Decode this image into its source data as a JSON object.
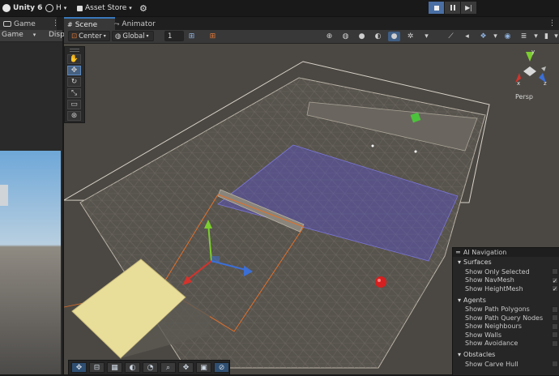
{
  "topbar": {
    "app_name": "Unity 6",
    "account_label": "H",
    "asset_store": "Asset Store"
  },
  "tabs": {
    "game": "Game",
    "scene": "Scene",
    "animator": "Animator"
  },
  "game_view": {
    "display_select": "Game",
    "display_label": "Disp"
  },
  "scene_toolbar": {
    "pivot_mode": "Center",
    "pivot_rotation": "Global",
    "grid_snap_value": "1"
  },
  "gizmo": {
    "projection": "Persp",
    "axis_y": "y",
    "axis_x": "x",
    "axis_z": "z"
  },
  "ai_navigation": {
    "title": "AI Navigation",
    "sections": [
      {
        "name": "Surfaces",
        "items": [
          {
            "label": "Show Only Selected",
            "checked": false
          },
          {
            "label": "Show NavMesh",
            "checked": true
          },
          {
            "label": "Show HeightMesh",
            "checked": true
          }
        ]
      },
      {
        "name": "Agents",
        "items": [
          {
            "label": "Show Path Polygons",
            "checked": false
          },
          {
            "label": "Show Path Query Nodes",
            "checked": false
          },
          {
            "label": "Show Neighbours",
            "checked": false
          },
          {
            "label": "Show Walls",
            "checked": false
          },
          {
            "label": "Show Avoidance",
            "checked": false
          }
        ]
      },
      {
        "name": "Obstacles",
        "items": [
          {
            "label": "Show Carve Hull",
            "checked": false
          }
        ]
      }
    ]
  },
  "colors": {
    "accent_blue": "#3a79bb",
    "navmesh_region": "#5a55c8",
    "selection_orange": "#e0702a",
    "gizmo_x": "#d3332c",
    "gizmo_y": "#7ccd2e",
    "gizmo_z": "#3b6fd6",
    "ground_highlight": "#e9dd9a"
  }
}
